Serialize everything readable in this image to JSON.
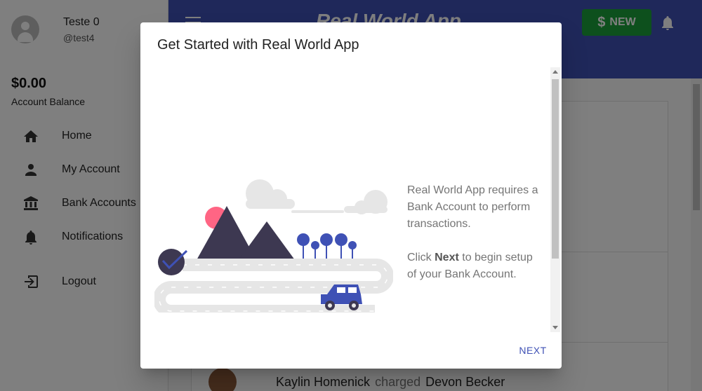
{
  "app": {
    "brand": "Real World App",
    "new_button": {
      "icon": "$",
      "label": "NEW"
    }
  },
  "user": {
    "name": "Teste 0",
    "handle": "@test4"
  },
  "account": {
    "balance": "$0.00",
    "balance_label": "Account Balance"
  },
  "sidebar": {
    "items": [
      {
        "label": "Home",
        "icon": "home-icon"
      },
      {
        "label": "My Account",
        "icon": "person-icon"
      },
      {
        "label": "Bank Accounts",
        "icon": "bank-icon"
      },
      {
        "label": "Notifications",
        "icon": "bell-icon"
      },
      {
        "label": "Logout",
        "icon": "logout-icon"
      }
    ]
  },
  "feed": {
    "row": {
      "sender": "Kaylin Homenick",
      "action": "charged",
      "receiver": "Devon Becker"
    }
  },
  "dialog": {
    "title": "Get Started with Real World App",
    "text1": "Real World App requires a Bank Account to perform transactions.",
    "text2_prefix": "Click ",
    "text2_bold": "Next",
    "text2_suffix": " to begin setup of your Bank Account.",
    "next_label": "NEXT"
  },
  "colors": {
    "primary": "#3f51b5",
    "new_button": "#1aa13a",
    "mountain": "#3d3851",
    "sun": "#ff6584",
    "road": "#e6e6e6"
  }
}
